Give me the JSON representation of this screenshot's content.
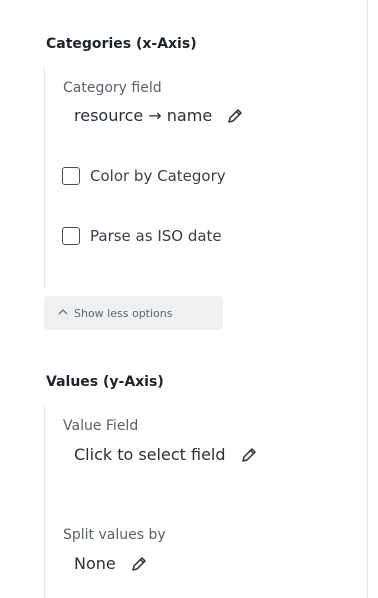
{
  "categories": {
    "title": "Categories (x-Axis)",
    "field_label": "Category field",
    "field_value": "resource → name",
    "color_by_label": "Color by Category",
    "parse_iso_label": "Parse as ISO date"
  },
  "options_toggle": {
    "label": "Show less options",
    "icon": "chevron-up-icon"
  },
  "values": {
    "title": "Values (y-Axis)",
    "field_label": "Value Field",
    "field_value": "Click to select field",
    "split_label": "Split values by",
    "split_value": "None"
  },
  "icons": {
    "edit": "pencil-icon",
    "checkbox": "checkbox-icon"
  },
  "colors": {
    "rail": "#e6e8ec",
    "button_bg": "#eef0f2",
    "text": "#2b2f36"
  }
}
